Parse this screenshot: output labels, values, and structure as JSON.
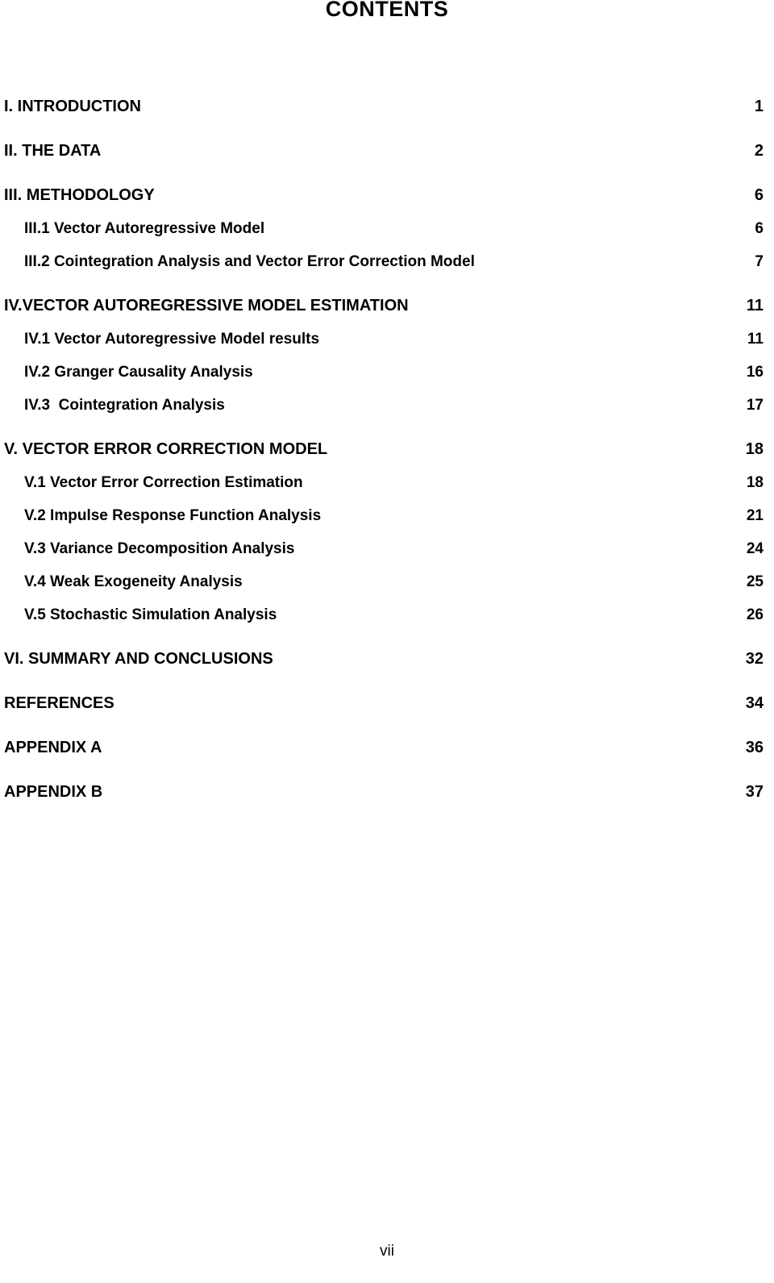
{
  "document": {
    "title": "CONTENTS",
    "footer_page_label": "vii"
  },
  "toc": {
    "entries": [
      {
        "label": "I. INTRODUCTION",
        "page": "1",
        "level": 0,
        "gap": "none"
      },
      {
        "label": "II. THE DATA",
        "page": "2",
        "level": 0,
        "gap": "large"
      },
      {
        "label": "III. METHODOLOGY",
        "page": "6",
        "level": 0,
        "gap": "large"
      },
      {
        "label": "III.1 Vector Autoregressive Model",
        "page": "6",
        "level": 1,
        "gap": "none"
      },
      {
        "label": "III.2 Cointegration Analysis and Vector Error Correction Model",
        "page": "7",
        "level": 1,
        "gap": "none"
      },
      {
        "label": "IV.VECTOR AUTOREGRESSIVE MODEL ESTIMATION",
        "page": "11",
        "level": 0,
        "gap": "large"
      },
      {
        "label": "IV.1 Vector Autoregressive Model results",
        "page": "11",
        "level": 1,
        "gap": "none"
      },
      {
        "label": "IV.2 Granger Causality Analysis",
        "page": "16",
        "level": 1,
        "gap": "none"
      },
      {
        "label": "IV.3  Cointegration Analysis",
        "page": "17",
        "level": 1,
        "gap": "none"
      },
      {
        "label": "V. VECTOR ERROR CORRECTION MODEL",
        "page": "18",
        "level": 0,
        "gap": "large"
      },
      {
        "label": "V.1 Vector Error Correction Estimation",
        "page": "18",
        "level": 1,
        "gap": "none"
      },
      {
        "label": "V.2 Impulse Response Function Analysis",
        "page": "21",
        "level": 1,
        "gap": "none"
      },
      {
        "label": "V.3 Variance Decomposition Analysis",
        "page": "24",
        "level": 1,
        "gap": "none"
      },
      {
        "label": "V.4 Weak Exogeneity Analysis",
        "page": "25",
        "level": 1,
        "gap": "none"
      },
      {
        "label": "V.5 Stochastic Simulation Analysis",
        "page": "26",
        "level": 1,
        "gap": "none"
      },
      {
        "label": "VI. SUMMARY AND CONCLUSIONS",
        "page": "32",
        "level": 0,
        "gap": "large"
      },
      {
        "label": "REFERENCES",
        "page": "34",
        "level": 0,
        "gap": "large"
      },
      {
        "label": "APPENDIX A",
        "page": "36",
        "level": 0,
        "gap": "large"
      },
      {
        "label": "APPENDIX B",
        "page": "37",
        "level": 0,
        "gap": "large"
      }
    ]
  }
}
